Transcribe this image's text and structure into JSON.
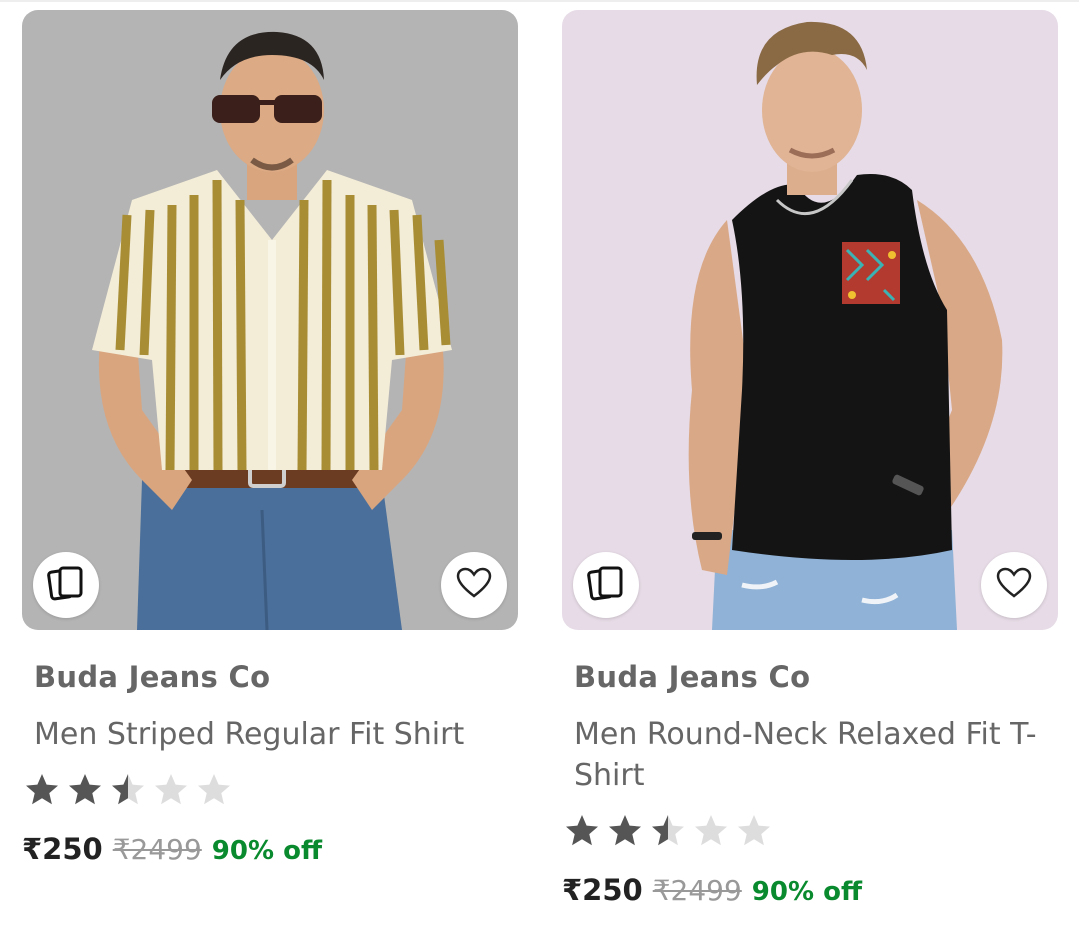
{
  "products": [
    {
      "brand": "Buda Jeans Co",
      "title": "Men Striped Regular Fit Shirt",
      "rating": 2.5,
      "rating_max": 5,
      "price": "₹250",
      "mrp": "₹2499",
      "discount": "90% off",
      "similar_icon": "similar-products-icon",
      "wishlist_icon": "heart-outline-icon",
      "image_bg": "#b4b4b4"
    },
    {
      "brand": "Buda Jeans Co",
      "title": "Men Round-Neck Relaxed Fit T-Shirt",
      "rating": 2.5,
      "rating_max": 5,
      "price": "₹250",
      "mrp": "₹2499",
      "discount": "90% off",
      "similar_icon": "similar-products-icon",
      "wishlist_icon": "heart-outline-icon",
      "image_bg": "#e6dbe6"
    }
  ],
  "colors": {
    "star_filled": "#555555",
    "star_empty": "#dddddd",
    "discount": "#0a8a2e",
    "text_muted": "#666666"
  }
}
